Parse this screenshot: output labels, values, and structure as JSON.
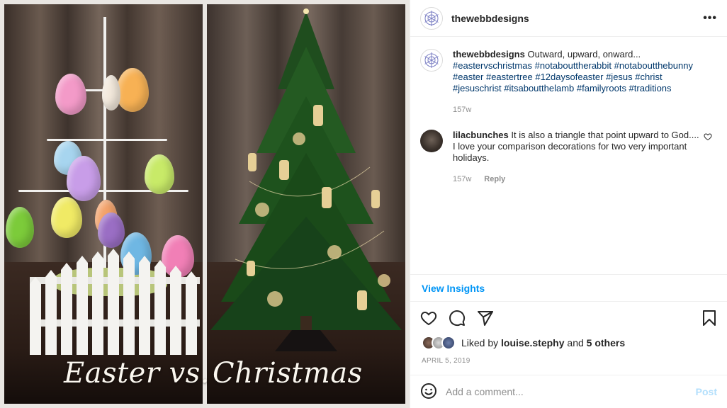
{
  "post": {
    "image_caption_left": "Easter vs.",
    "image_caption_right": "Christmas"
  },
  "header": {
    "username": "thewebbdesigns",
    "more_icon": "more-horizontal-icon"
  },
  "caption_comment": {
    "username": "thewebbdesigns",
    "text": "Outward, upward, onward...",
    "hashtags": "#eastervschristmas #notabouttherabbit #notaboutthebunny #easter #eastertree #12daysofeaster #jesus #christ #jesuschrist #itsaboutthelamb #familyroots #traditions",
    "age": "157w"
  },
  "comment": {
    "username": "lilacbunches",
    "text": "It is also a triangle that point upward to God.... I love your comparison decorations for two very important holidays.",
    "age": "157w",
    "reply_label": "Reply"
  },
  "insights": {
    "label": "View Insights"
  },
  "likes": {
    "prefix": "Liked by",
    "user": "louise.stephy",
    "joiner": "and",
    "others": "5 others"
  },
  "date": "APRIL 5, 2019",
  "add_comment": {
    "placeholder": "Add a comment...",
    "post_label": "Post"
  },
  "colors": {
    "link": "#00376b",
    "accent": "#0095f6",
    "post_disabled": "#b2dffc",
    "muted": "#8e8e8e"
  }
}
